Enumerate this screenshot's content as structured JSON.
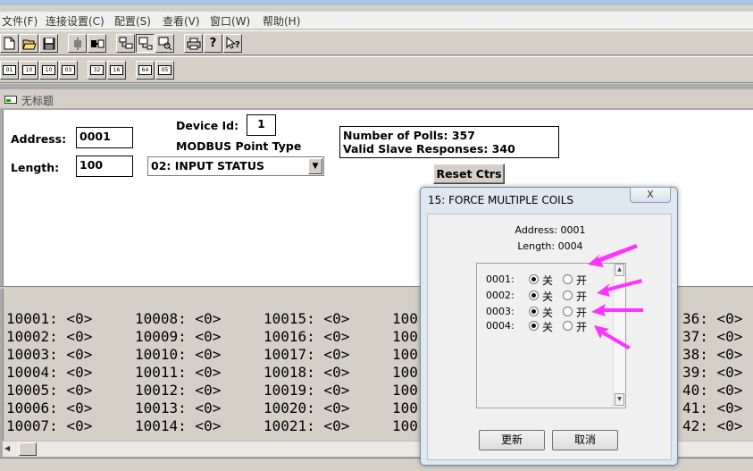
{
  "menu": {
    "items": [
      {
        "label": "文件(F)"
      },
      {
        "label": "连接设置(C)"
      },
      {
        "label": "配置(S)"
      },
      {
        "label": "查看(V)"
      },
      {
        "label": "窗口(W)"
      },
      {
        "label": "帮助(H)"
      }
    ]
  },
  "toolbar2": {
    "buttons": [
      "01",
      "10",
      "10",
      "03",
      "32",
      "16",
      "64",
      "05"
    ]
  },
  "child_window": {
    "title": "无标题"
  },
  "form": {
    "address_label": "Address:",
    "address_value": "0001",
    "length_label": "Length:",
    "length_value": "100",
    "device_id_label": "Device Id:",
    "device_id_value": "1",
    "point_type_label": "MODBUS Point Type",
    "point_type_value": "02: INPUT STATUS",
    "polls_text": "Number of Polls: 357",
    "responses_text": "Valid Slave Responses: 340",
    "reset_button": "Reset Ctrs"
  },
  "data_rows": [
    [
      "10001: <0>",
      "10008: <0>",
      "10015: <0>",
      "100",
      "36: <0>"
    ],
    [
      "10002: <0>",
      "10009: <0>",
      "10016: <0>",
      "100",
      "37: <0>"
    ],
    [
      "10003: <0>",
      "10010: <0>",
      "10017: <0>",
      "100",
      "38: <0>"
    ],
    [
      "10004: <0>",
      "10011: <0>",
      "10018: <0>",
      "100",
      "39: <0>"
    ],
    [
      "10005: <0>",
      "10012: <0>",
      "10019: <0>",
      "100",
      "40: <0>"
    ],
    [
      "10006: <0>",
      "10013: <0>",
      "10020: <0>",
      "100",
      "41: <0>"
    ],
    [
      "10007: <0>",
      "10014: <0>",
      "10021: <0>",
      "100",
      "42: <0>"
    ]
  ],
  "dialog": {
    "title": "15: FORCE MULTIPLE COILS",
    "close_label": "X",
    "address_text": "Address: 0001",
    "length_text": "Length: 0004",
    "off_label": "关",
    "on_label": "开",
    "coils": [
      {
        "address": "0001:",
        "state": "off"
      },
      {
        "address": "0002:",
        "state": "off"
      },
      {
        "address": "0003:",
        "state": "off"
      },
      {
        "address": "0004:",
        "state": "off"
      }
    ],
    "update_button": "更新",
    "cancel_button": "取消"
  },
  "colors": {
    "annotation_arrow": "#ff33ff",
    "window_bg": "#d4d0c8",
    "dialog_bg": "#dfe7f1"
  }
}
